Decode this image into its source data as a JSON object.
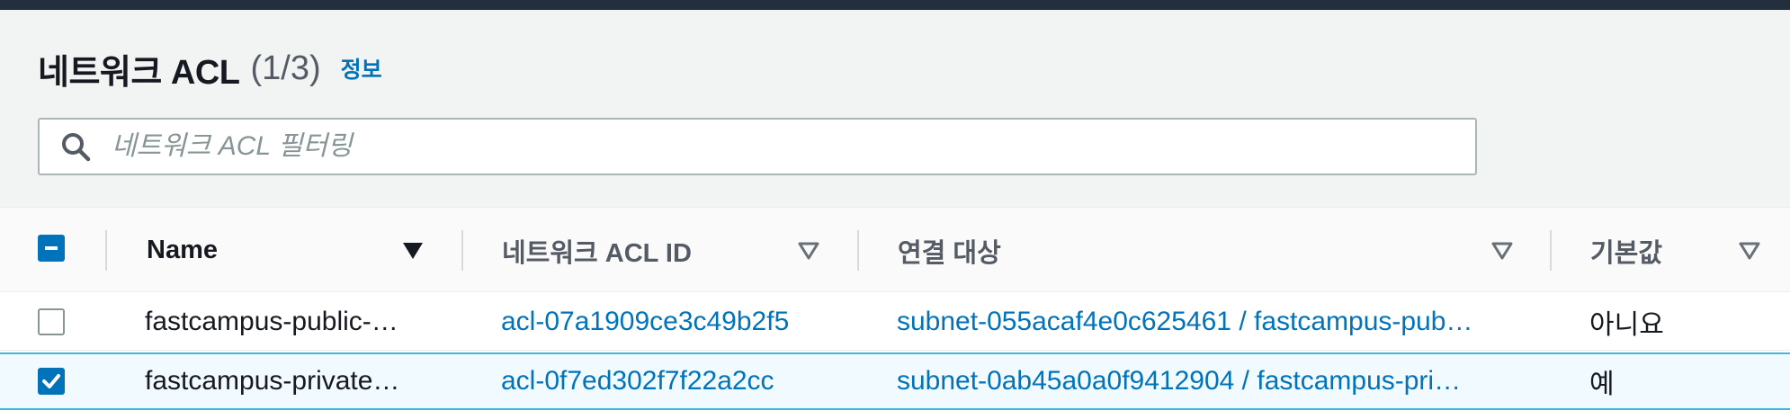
{
  "header": {
    "title": "네트워크 ACL",
    "count": "(1/3)",
    "info_link": "정보"
  },
  "search": {
    "placeholder": "네트워크 ACL 필터링",
    "value": ""
  },
  "table": {
    "columns": [
      {
        "label": "Name",
        "sort": "sorted-desc"
      },
      {
        "label": "네트워크 ACL ID",
        "sort": "sortable"
      },
      {
        "label": "연결 대상",
        "sort": "sortable"
      },
      {
        "label": "기본값",
        "sort": "sortable"
      }
    ],
    "rows": [
      {
        "selected": false,
        "name": "fastcampus-public-…",
        "acl_id": "acl-07a1909ce3c49b2f5",
        "associated_with": "subnet-055acaf4e0c625461 / fastcampus-pub…",
        "default": "아니요"
      },
      {
        "selected": true,
        "name": "fastcampus-private…",
        "acl_id": "acl-0f7ed302f7f22a2cc",
        "associated_with": "subnet-0ab45a0a0f9412904 / fastcampus-pri…",
        "default": "예"
      }
    ]
  },
  "colors": {
    "accent": "#0073bb",
    "selected_row_bg": "#f1faff",
    "selected_row_border": "#44b9d6",
    "top_bar": "#232f3e"
  },
  "icons": {
    "search": "search-icon",
    "sort_desc": "caret-down-filled-icon",
    "sortable": "caret-down-outline-icon"
  }
}
